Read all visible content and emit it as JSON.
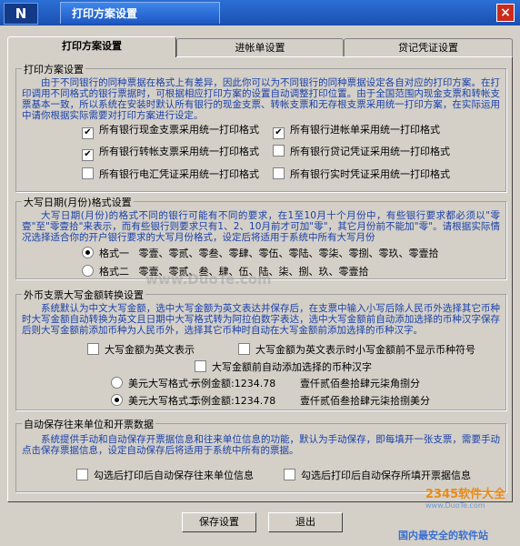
{
  "window": {
    "title": "打印方案设置",
    "logo": "N"
  },
  "tabs": [
    "打印方案设置",
    "进帐单设置",
    "贷记凭证设置"
  ],
  "group1": {
    "legend": "打印方案设置",
    "desc": "由于不同银行的同种票据在格式上有差异，因此你可以为不同银行的同种票据设定各自对应的打印方案。在打印调用不同格式的银行票据时，可根据相应打印方案的设置自动调整打印位置。由于全国范围内现金支票和转帐支票基本一致，所以系统在安装时默认所有银行的现金支票、转帐支票和无存根支票采用统一打印方案，在实际运用中请你根据实际需要对打印方案进行设定。",
    "items": [
      {
        "label": "所有银行现金支票采用统一打印格式",
        "checked": true
      },
      {
        "label": "所有银行进帐单采用统一打印格式",
        "checked": true
      },
      {
        "label": "所有银行转帐支票采用统一打印格式",
        "checked": true
      },
      {
        "label": "所有银行贷记凭证采用统一打印格式",
        "checked": false
      },
      {
        "label": "所有银行电汇凭证采用统一打印格式",
        "checked": false
      },
      {
        "label": "所有银行实时凭证采用统一打印格式",
        "checked": false
      }
    ]
  },
  "group2": {
    "legend": "大写日期(月份)格式设置",
    "desc": "大写日期(月份)的格式不同的银行可能有不同的要求，在1至10月十个月份中，有些银行要求都必须以\"零壹\"至\"零壹拾\"来表示，而有些银行则要求只有1、2、10月前才可加\"零\"，其它月份前不能加\"零\"。请根据实际情况选择适合你的开户银行要求的大写月份格式，设定后将适用于系统中所有大写月份",
    "formats": [
      {
        "name": "格式一",
        "months": "零壹、零贰、零叁、零肆、零伍、零陆、零柒、零捌、零玖、零壹拾",
        "selected": true
      },
      {
        "name": "格式二",
        "months": "零壹、零贰、叁、肆、伍、陆、柒、捌、玖、零壹拾",
        "selected": false
      }
    ]
  },
  "group3": {
    "legend": "外币支票大写金额转换设置",
    "desc": "系统默认为中文大写金额，选中大写金额为英文表达并保存后，在支票中输入小写后除人民币外选择其它币种时大写金额自动转换为英文且日期中大写格式转为阿拉伯数字表达，选中大写金额前自动添加选择的币种汉字保存后则大写金额前添加币种为人民币外，选择其它币种时自动在大写金额前添加选择的币种汉字。",
    "checks": [
      {
        "label": "大写金额为英文表示",
        "checked": false
      },
      {
        "label": "大写金额为英文表示时小写金额前不显示币种符号",
        "checked": false
      },
      {
        "label": "大写金额前自动添加选择的币种汉字",
        "checked": false
      }
    ],
    "usd": [
      {
        "name": "美元大写格式一",
        "example_label": "示例金额:1234.78",
        "example": "壹仟贰佰叁拾肆元柒角捌分",
        "selected": false
      },
      {
        "name": "美元大写格式二",
        "example_label": "示例金额:1234.78",
        "example": "壹仟贰佰叁拾肆元柒拾捌美分",
        "selected": true
      }
    ]
  },
  "group4": {
    "legend": "自动保存往来单位和开票数据",
    "desc": "系统提供手动和自动保存开票据信息和往来单位信息的功能，默认为手动保存，即每填开一张支票，需要手动点击保存票据信息，设定自动保存后将适用于系统中所有的票据。",
    "checks": [
      {
        "label": "勾选后打印后自动保存往来单位信息",
        "checked": false
      },
      {
        "label": "勾选后打印后自动保存所填开票据信息",
        "checked": false
      }
    ]
  },
  "buttons": {
    "save": "保存设置",
    "exit": "退出"
  },
  "watermarks": {
    "center": "www.DuoTe.com",
    "logo_big": "2345软件大全",
    "logo_small": "www.DuoTe.com",
    "bottom": "国内最安全的软件站"
  }
}
